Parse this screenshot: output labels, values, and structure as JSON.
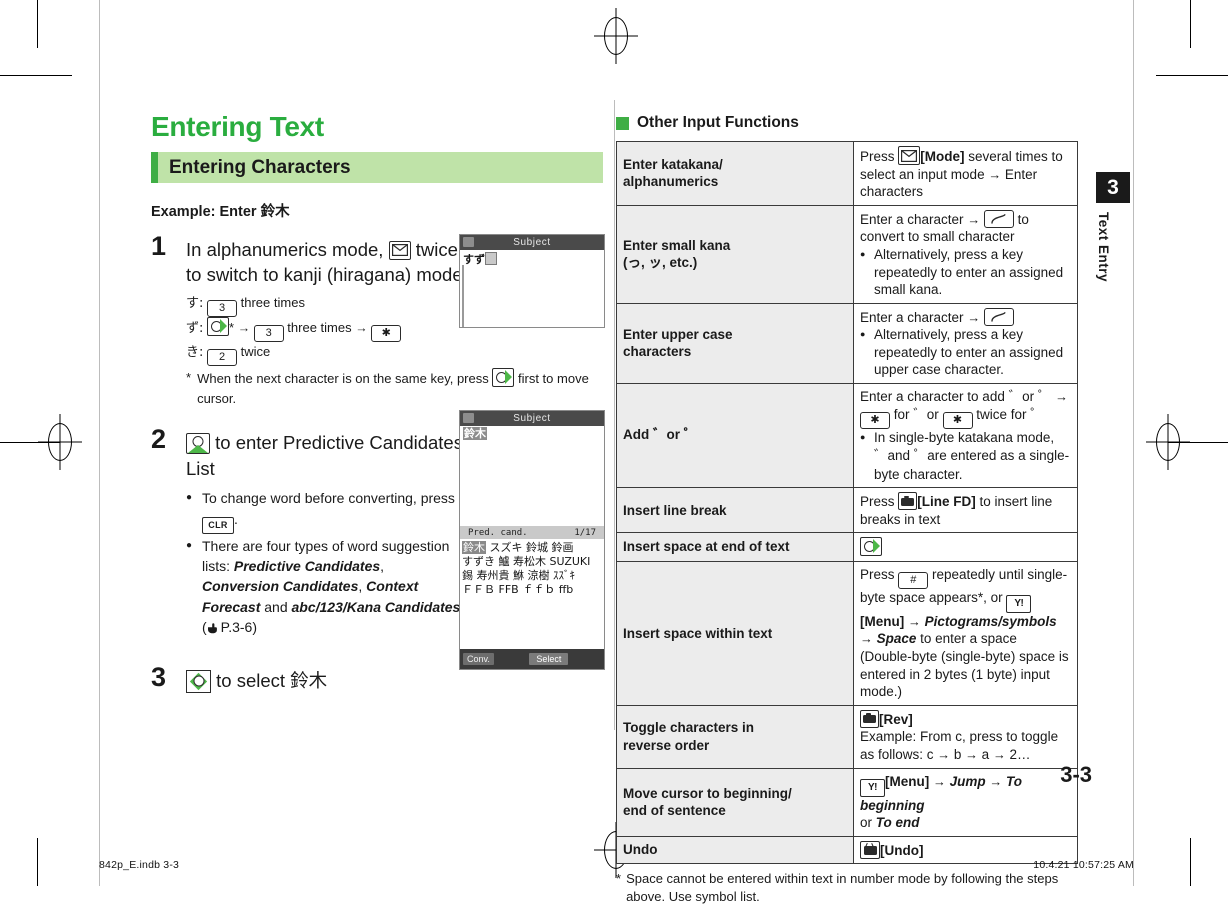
{
  "page": {
    "number": "3-3",
    "chapter_tab": {
      "number": "3",
      "label": "Text Entry"
    },
    "footer_left": "842p_E.indb   3-3",
    "footer_right": "10.4.21   10:57:25 AM"
  },
  "colors": {
    "brand_green": "#2aad3f",
    "section_bar_bg": "#bfe3a8",
    "section_bar_accent": "#3fae45",
    "table_key_bg": "#ececec",
    "table_border": "#3a3a3a"
  },
  "left": {
    "chapter_title": "Entering Text",
    "section_title": "Entering Characters",
    "example_label": "Example: Enter 鈴木",
    "steps": [
      {
        "num": "1",
        "head_before": "In alphanumerics mode,",
        "head_icon": "mail-key-icon",
        "head_after": "twice to switch to kanji (hiragana) mode",
        "substeps": [
          {
            "kana": "す:",
            "key": "3",
            "after": "three times"
          },
          {
            "kana": "ず:",
            "nav_then": "*",
            "arrow1": "→",
            "key": "3",
            "mid": "three times",
            "arrow2": "→",
            "key2": "✱"
          },
          {
            "kana": "き:",
            "key": "2",
            "after": "twice"
          }
        ],
        "note": "When the next character is on the same key, press ⬤ first to move cursor.",
        "note_a": "When the next character is on the same key, press",
        "note_b": "first to move cursor."
      },
      {
        "num": "2",
        "head_icon": "nav-up-key-icon",
        "head_after": "to enter Predictive Candidates List",
        "bullets": [
          {
            "a": "To change word before converting, press",
            "key": "CLR",
            "b": "."
          },
          {
            "a": "There are four types of word suggestion lists:",
            "italics": [
              "Predictive Candidates",
              "Conversion Candidates",
              "Context Forecast",
              "abc/123/Kana Candidates"
            ],
            "and_word": "and",
            "ref": "P.3-6"
          }
        ]
      },
      {
        "num": "3",
        "head_icon": "nav-4way-key-icon",
        "head_after": "to select 鈴木"
      }
    ],
    "screenshots": [
      {
        "name": "compose-screen",
        "title": "Subject",
        "text": "すず",
        "has_caret": true
      },
      {
        "name": "predictive-candidates-screen",
        "title": "Subject",
        "text": "鈴木",
        "cand_bar_left": "Pred. cand.",
        "cand_bar_right": "1/17",
        "cand_rows": [
          {
            "selected": "鈴木",
            "rest": "スズキ  鈴城  鈴画"
          },
          {
            "rest": "すずき  鱸  寿松木  SUZUKI"
          },
          {
            "rest": "錫  寿州貴  鮴  涼樹  ｽｽﾞｷ"
          },
          {
            "rest": "ＦＦＢ  FFB  ｆｆｂ  ffb"
          }
        ],
        "softkey_left": "Conv.",
        "softkey_mid": "Select"
      }
    ]
  },
  "right": {
    "subhead": "Other Input Functions",
    "table": {
      "rows": [
        {
          "key": "Enter katakana/\nalphanumerics",
          "value_parts": [
            {
              "t": "Press "
            },
            {
              "icon": "mail-key-icon"
            },
            {
              "b": "[Mode]"
            },
            {
              "t": " several times to select an input mode "
            },
            {
              "t": "→ Enter characters"
            }
          ]
        },
        {
          "key": "Enter small kana\n(っ, ッ, etc.)",
          "value_parts": [
            {
              "t": "Enter a character → "
            },
            {
              "icon": "call-key-icon"
            },
            {
              "t": " to convert to small character"
            }
          ],
          "bullets": [
            "Alternatively, press a key repeatedly to enter an assigned small kana."
          ]
        },
        {
          "key": "Enter upper case\ncharacters",
          "value_parts": [
            {
              "t": "Enter a character → "
            },
            {
              "icon": "call-key-icon"
            }
          ],
          "bullets": [
            "Alternatively, press a key repeatedly to enter an assigned upper case character."
          ]
        },
        {
          "key": "Add ゛or ゜",
          "value_parts": [
            {
              "t": "Enter a character to add ゛or ゜ → "
            },
            {
              "icon": "star-key-icon"
            },
            {
              "t": " for ゛or "
            },
            {
              "icon": "star-key-icon"
            },
            {
              "t": " twice for ゜"
            }
          ],
          "bullets": [
            "In single-byte katakana mode, ゛and ゜are entered as a single-byte character."
          ]
        },
        {
          "key": "Insert line break",
          "value_parts": [
            {
              "t": "Press "
            },
            {
              "icon": "camera-key-icon"
            },
            {
              "b": "[Line FD]"
            },
            {
              "t": " to insert line breaks in text"
            }
          ]
        },
        {
          "key": "Insert space at end of text",
          "value_parts": [
            {
              "icon": "nav-right-key-icon"
            }
          ]
        },
        {
          "key": "Insert space within text",
          "value_parts": [
            {
              "t": "Press "
            },
            {
              "icon": "hash-key-icon"
            },
            {
              "t": " repeatedly until single-byte space appears*, or "
            },
            {
              "icon": "yahoo-key-icon"
            },
            {
              "b": "[Menu]"
            },
            {
              "t": " → "
            },
            {
              "i": "Pictograms/symbols"
            },
            {
              "t": " → "
            },
            {
              "i": "Space"
            },
            {
              "t": " to enter a space (Double-byte (single-byte) space is entered in 2 bytes (1 byte) input mode.)"
            }
          ]
        },
        {
          "key": "Toggle characters in\nreverse order",
          "value_parts": [
            {
              "icon": "camera-key-icon"
            },
            {
              "b": "[Rev]"
            },
            {
              "t": "\nExample: From c, press to toggle as follows: c → b → a → 2…"
            }
          ]
        },
        {
          "key": "Move cursor to beginning/\nend of sentence",
          "value_parts": [
            {
              "icon": "yahoo-key-icon"
            },
            {
              "b": "[Menu]"
            },
            {
              "t": " → "
            },
            {
              "i": "Jump"
            },
            {
              "t": " → "
            },
            {
              "i": "To beginning"
            },
            {
              "t": " or "
            },
            {
              "i": "To end"
            }
          ]
        },
        {
          "key": "Undo",
          "value_parts": [
            {
              "icon": "tv-key-icon"
            },
            {
              "b": "[Undo]"
            }
          ]
        }
      ]
    },
    "note": "Space cannot be entered within text in number mode by following the steps above. Use symbol list."
  },
  "icons": {
    "mail_key": "envelope-icon",
    "nav_key": "navigation-key-icon",
    "call_key": "call-key-icon",
    "camera_key": "camera-key-icon",
    "yahoo_key": "yahoo-key-icon",
    "tv_key": "tv-key-icon",
    "clr_key": "clear-key-icon"
  }
}
